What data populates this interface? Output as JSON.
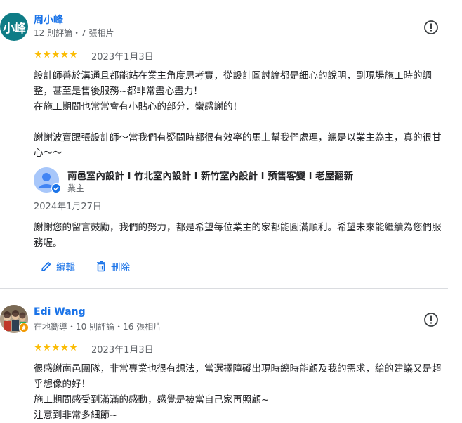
{
  "reviews": [
    {
      "avatar_text": "小峰",
      "avatar_color": "#0e7c86",
      "name": "周小峰",
      "meta": "12 則評論・7 張相片",
      "rating": 5,
      "stars": "★★★★★",
      "date": "2023年1月3日",
      "text": "設計師善於溝通且都能站在業主角度思考實，從設計圖討論都是細心的說明，到現場施工時的調整，甚至是售後服務~都非常盡心盡力！\n在施工期間也常常會有小貼心的部分，蠻感謝的！\n\n謝謝波賣跟張設計師～當我們有疑問時都很有效率的馬上幫我們處理，總是以業主為主，真的很甘心～～",
      "owner_reply": {
        "name": "南邑室內設計 l 竹北室內設計 l 新竹室內設計 l 預售客變 l 老屋翻新",
        "role": "業主",
        "date": "2024年1月27日",
        "text": "謝謝您的留言鼓勵，我們的努力，都是希望每位業主的家都能圓滿順利。希望未來能繼續為您們服務喔。",
        "edit_label": "編輯",
        "delete_label": "刪除"
      }
    },
    {
      "avatar_icon": "photo-avatar",
      "name": "Edi Wang",
      "meta": "在地嚮導・10 則評論・16 張相片",
      "rating": 5,
      "stars": "★★★★★",
      "date": "2023年1月3日",
      "text": "很感謝南邑團隊，非常專業也很有想法，當選擇障礙出現時總時能顧及我的需求，給的建議又是超乎想像的好！\n施工期間感受到滿滿的感動，感覺是被當自己家再照顧~\n注意到非常多細節~"
    }
  ],
  "colors": {
    "link_blue": "#1a73e8",
    "star_yellow": "#fbbc04",
    "divider": "#dadce0",
    "secondary_text": "#5f6368"
  }
}
